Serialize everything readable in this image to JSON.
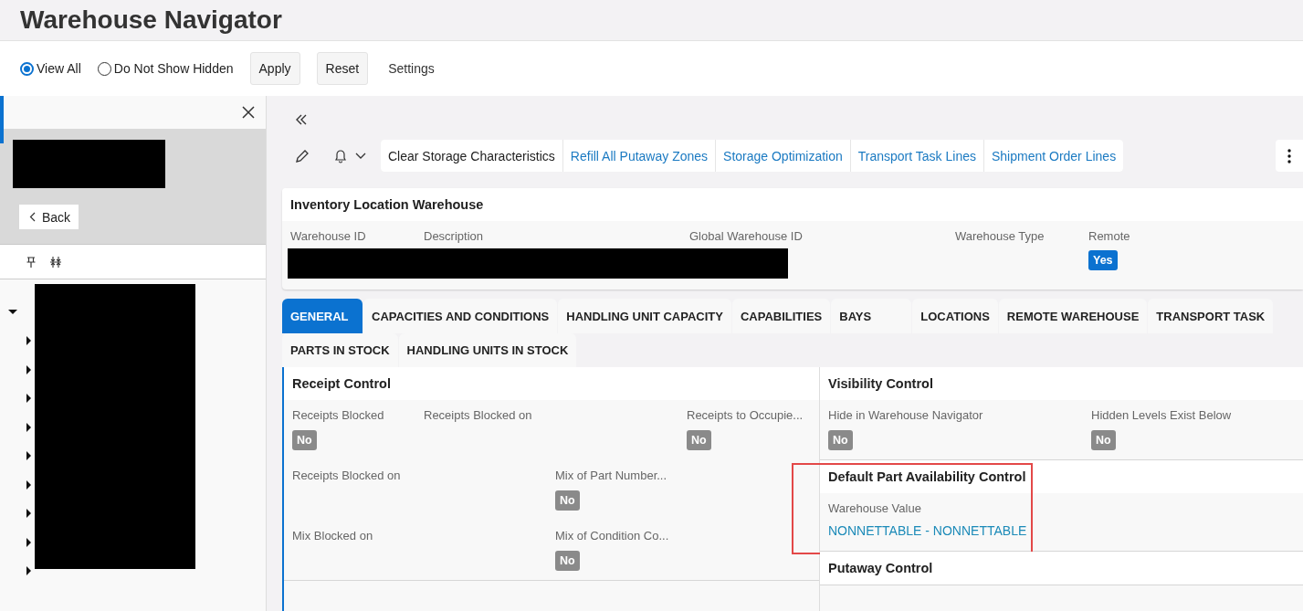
{
  "header": {
    "title": "Warehouse Navigator"
  },
  "filter_bar": {
    "options": [
      {
        "label": "View All",
        "selected": true
      },
      {
        "label": "Do Not Show Hidden",
        "selected": false
      }
    ],
    "buttons": [
      "Apply",
      "Reset"
    ],
    "settings_link": "Settings"
  },
  "side_panel": {
    "back_label": "Back",
    "tree": [
      {
        "expanded": true,
        "children": [
          {
            "expanded": false
          },
          {
            "expanded": false
          },
          {
            "expanded": false
          },
          {
            "expanded": false
          },
          {
            "expanded": false
          },
          {
            "expanded": false
          },
          {
            "expanded": false
          },
          {
            "expanded": false
          },
          {
            "expanded": false
          }
        ]
      }
    ]
  },
  "commands": [
    {
      "label": "Clear Storage Characteristics",
      "enabled": false
    },
    {
      "label": "Refill All Putaway Zones",
      "enabled": true
    },
    {
      "label": "Storage Optimization",
      "enabled": true
    },
    {
      "label": "Transport Task Lines",
      "enabled": true
    },
    {
      "label": "Shipment Order Lines",
      "enabled": true
    }
  ],
  "record": {
    "title": "Inventory Location Warehouse",
    "fields": [
      {
        "label": "Warehouse ID",
        "kind": "redacted"
      },
      {
        "label": "Description",
        "kind": "blank"
      },
      {
        "label": "Global Warehouse ID",
        "kind": "blank"
      },
      {
        "label": "Warehouse Type",
        "kind": "blank"
      },
      {
        "label": "Remote",
        "kind": "toggle",
        "value": "Yes",
        "on": true
      }
    ]
  },
  "tabs": [
    [
      {
        "label": "GENERAL",
        "selected": true
      },
      {
        "label": "CAPACITIES AND CONDITIONS",
        "selected": false
      },
      {
        "label": "HANDLING UNIT CAPACITY",
        "selected": false
      },
      {
        "label": "CAPABILITIES",
        "selected": false
      },
      {
        "label": "BAYS",
        "selected": false
      },
      {
        "label": "LOCATIONS",
        "selected": false
      },
      {
        "label": "REMOTE WAREHOUSE",
        "selected": false
      },
      {
        "label": "TRANSPORT TASK",
        "selected": false
      }
    ],
    [
      {
        "label": "PARTS IN STOCK",
        "selected": false
      },
      {
        "label": "HANDLING UNITS IN STOCK",
        "selected": false
      }
    ]
  ],
  "left_sections": [
    {
      "title": "Receipt Control",
      "highlighted": false,
      "fields": [
        {
          "label": "Receipts Blocked",
          "kind": "toggle",
          "value": "No",
          "on": false
        },
        {
          "label": "Receipts Blocked on",
          "kind": "date"
        },
        {
          "label": "Receipts to Occupie...",
          "kind": "toggle",
          "value": "No",
          "on": false
        },
        {
          "label": "Receipts Blocked on",
          "kind": "date"
        },
        {
          "label": "Mix of Part Number...",
          "kind": "toggle",
          "value": "No",
          "on": false
        },
        {
          "label": "Mix Blocked on",
          "kind": "date"
        },
        {
          "label": "Mix of Condition Co...",
          "kind": "toggle",
          "value": "No",
          "on": false
        }
      ]
    }
  ],
  "right_sections": [
    {
      "title": "Visibility Control",
      "highlighted": false,
      "fields": [
        {
          "label": "Hide in Warehouse Navigator",
          "kind": "toggle",
          "value": "No",
          "on": false
        },
        {
          "label": "Hidden Levels Exist Below",
          "kind": "toggle",
          "value": "No",
          "on": false
        }
      ]
    },
    {
      "title": "Default Part Availability Control",
      "highlighted": true,
      "fields": [
        {
          "label": "Warehouse Value",
          "kind": "link",
          "value": "NONNETTABLE - NONNETTABLE"
        }
      ]
    },
    {
      "title": "Putaway Control",
      "highlighted": false
    }
  ]
}
